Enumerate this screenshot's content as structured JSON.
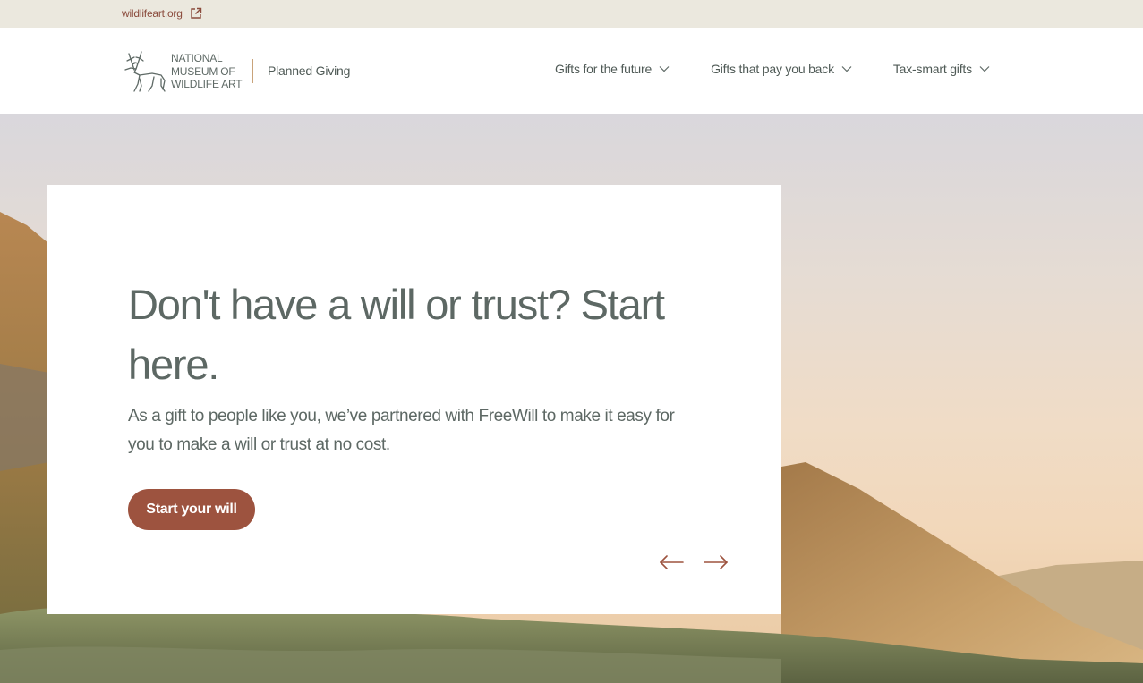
{
  "utility": {
    "link_text": "wildlifeart.org",
    "link_icon": "external-link-icon"
  },
  "header": {
    "logo": {
      "icon": "elk-icon",
      "lines": [
        "NATIONAL",
        "MUSEUM OF",
        "WILDLIFE ART"
      ]
    },
    "site_name": "Planned Giving",
    "nav": [
      {
        "label": "Gifts for the future",
        "icon": "chevron-down-icon"
      },
      {
        "label": "Gifts that pay you back",
        "icon": "chevron-down-icon"
      },
      {
        "label": "Tax-smart gifts",
        "icon": "chevron-down-icon"
      }
    ]
  },
  "hero": {
    "title": "Don't have a will or trust? Start here.",
    "body": "As a gift to people like you, we’ve partnered with FreeWill to make it easy for you to make a will or trust at no cost.",
    "cta_label": "Start your will",
    "prev_icon": "arrow-left-icon",
    "next_icon": "arrow-right-icon"
  },
  "colors": {
    "accent": "#9d533f",
    "text": "#5d6864",
    "utility_bg": "#ebe8de",
    "link": "#8a4a3b"
  }
}
